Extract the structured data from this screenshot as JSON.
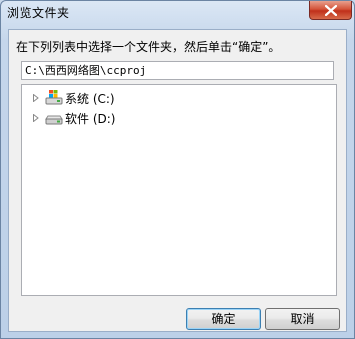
{
  "window": {
    "title": "浏览文件夹"
  },
  "dialog": {
    "instruction": "在下列列表中选择一个文件夹，然后单击“确定”。",
    "path_value": "C:\\西西网络图\\ccproj"
  },
  "tree": {
    "items": [
      {
        "label": "系统 (C:)",
        "icon": "system-drive-icon"
      },
      {
        "label": "软件 (D:)",
        "icon": "local-drive-icon"
      }
    ]
  },
  "buttons": {
    "ok_label": "确定",
    "cancel_label": "取消"
  },
  "colors": {
    "close_button": "#c0301a",
    "default_button_border": "#3c7fb1"
  }
}
